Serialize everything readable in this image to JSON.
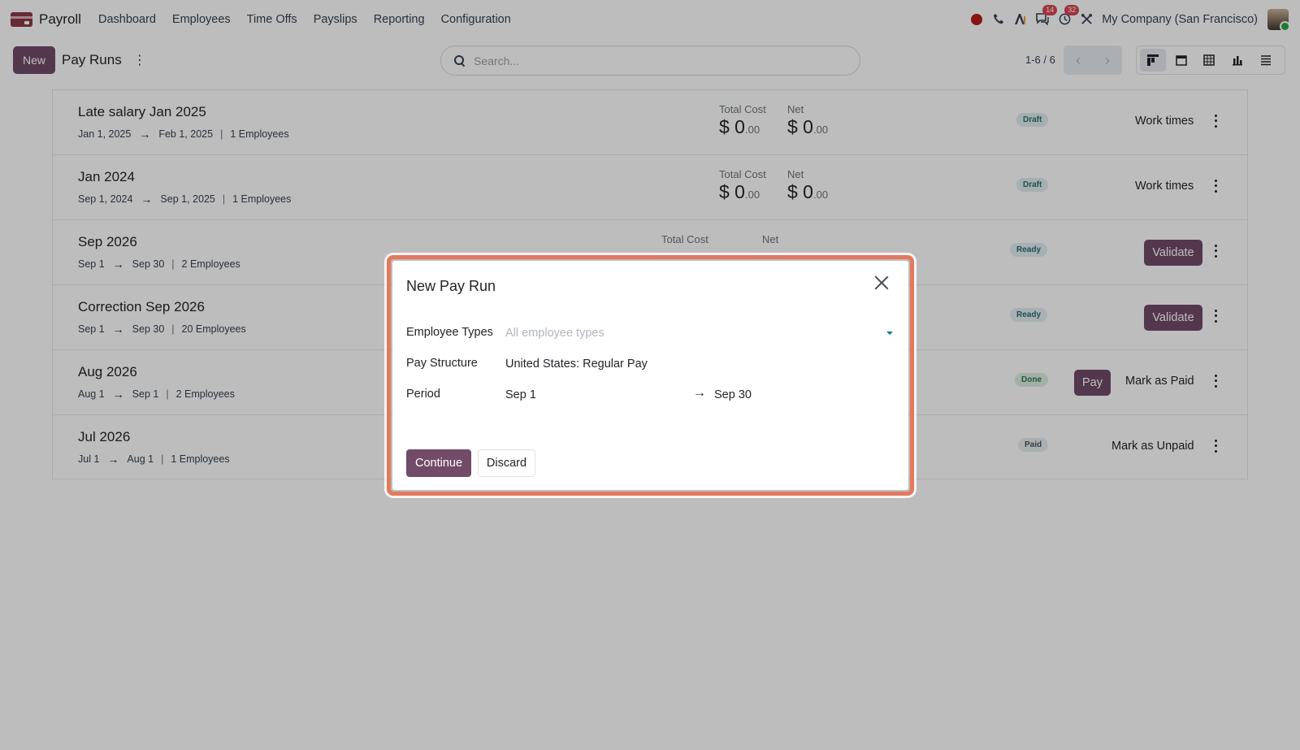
{
  "nav": {
    "app_name": "Payroll",
    "menu": [
      "Dashboard",
      "Employees",
      "Time Offs",
      "Payslips",
      "Reporting",
      "Configuration"
    ],
    "messages_count": "14",
    "activities_count": "32",
    "company": "My Company (San Francisco)"
  },
  "control_panel": {
    "new_label": "New",
    "title": "Pay Runs",
    "search_placeholder": "Search...",
    "pager": "1-6 / 6"
  },
  "runs": [
    {
      "name": "Late salary Jan 2025",
      "start": "Jan 1, 2025",
      "end": "Feb 1, 2025",
      "employees": "1 Employees",
      "total_cost_label": "Total Cost",
      "total_cost": "$ 0",
      "total_cost_cents": ".00",
      "net_label": "Net",
      "net": "$ 0",
      "net_cents": ".00",
      "status": "Draft",
      "action": "Work times"
    },
    {
      "name": "Jan 2024",
      "start": "Sep 1, 2024",
      "end": "Sep 1, 2025",
      "employees": "1 Employees",
      "total_cost_label": "Total Cost",
      "total_cost": "$ 0",
      "total_cost_cents": ".00",
      "net_label": "Net",
      "net": "$ 0",
      "net_cents": ".00",
      "status": "Draft",
      "action": "Work times"
    },
    {
      "name": "Sep 2026",
      "start": "Sep 1",
      "end": "Sep 30",
      "employees": "2 Employees",
      "total_cost_label": "Total Cost",
      "net_label": "Net",
      "status": "Ready",
      "action": "Validate"
    },
    {
      "name": "Correction Sep 2026",
      "start": "Sep 1",
      "end": "Sep 30",
      "employees": "20 Employees",
      "status": "Ready",
      "action": "Validate"
    },
    {
      "name": "Aug 2026",
      "start": "Aug 1",
      "end": "Sep 1",
      "employees": "2 Employees",
      "status": "Done",
      "pay_label": "Pay",
      "action": "Mark as Paid"
    },
    {
      "name": "Jul 2026",
      "start": "Jul 1",
      "end": "Aug 1",
      "employees": "1 Employees",
      "status": "Paid",
      "action": "Mark as Unpaid"
    }
  ],
  "modal": {
    "title": "New Pay Run",
    "employee_types_label": "Employee Types",
    "employee_types_placeholder": "All employee types",
    "pay_structure_label": "Pay Structure",
    "pay_structure_value": "United States: Regular Pay",
    "period_label": "Period",
    "period_start": "Sep 1",
    "period_end": "Sep 30",
    "continue_label": "Continue",
    "discard_label": "Discard"
  },
  "colors": {
    "brand": "#714b67",
    "highlight_ring": "#e4795e",
    "badge": "#d84654"
  }
}
